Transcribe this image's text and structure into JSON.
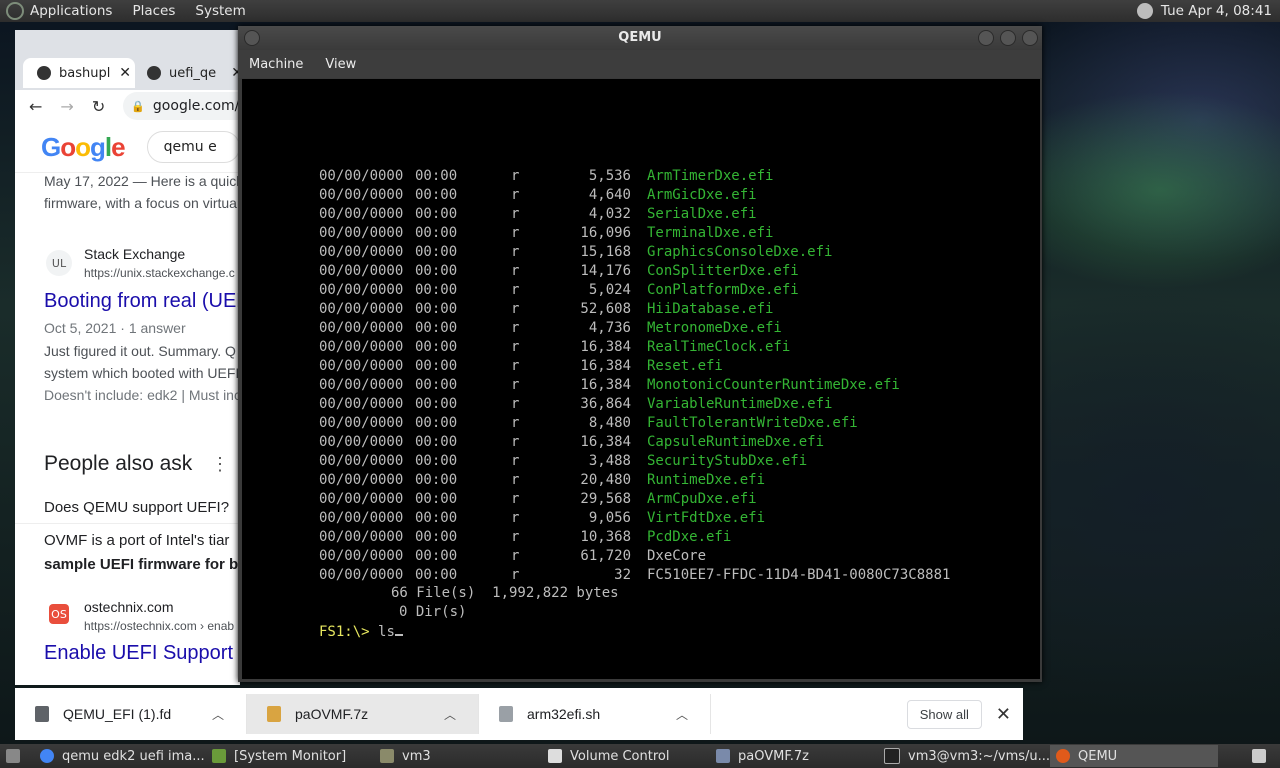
{
  "topbar": {
    "menus": [
      "Applications",
      "Places",
      "System"
    ],
    "clock": "Tue Apr  4, 08:41"
  },
  "browser": {
    "tabs": [
      {
        "label": "bashupl"
      },
      {
        "label": "uefi_qe"
      }
    ],
    "url": "google.com/",
    "search": "qemu e",
    "results": {
      "snip1_date": "May 17, 2022 — Here is a quick",
      "snip1_line2": "firmware, with a focus on virtua",
      "site1": "Stack Exchange",
      "site1_url": "https://unix.stackexchange.c",
      "title1": "Booting from real (UEF",
      "meta1": "Oct 5, 2021 · 1 answer",
      "snip2_line1": "Just figured it out. Summary. Q",
      "snip2_line2": "system which booted with UEFI",
      "snip2_line3": "Doesn't include: edk2 | Must inc",
      "paa": "People also ask",
      "q1": "Does QEMU support UEFI?",
      "a1_line1": "OVMF is a port of Intel's tiar",
      "a1_line2": "sample UEFI firmware for b",
      "site2": "ostechnix.com",
      "site2_url": "https://ostechnix.com › enab",
      "title2": "Enable UEFI Support F"
    }
  },
  "qemu": {
    "title": "QEMU",
    "menu": [
      "Machine",
      "View"
    ],
    "files": [
      {
        "date": "00/00/0000",
        "time": "00:00",
        "attr": "r",
        "size": "5,536",
        "name": "ArmTimerDxe.efi",
        "green": true
      },
      {
        "date": "00/00/0000",
        "time": "00:00",
        "attr": "r",
        "size": "4,640",
        "name": "ArmGicDxe.efi",
        "green": true
      },
      {
        "date": "00/00/0000",
        "time": "00:00",
        "attr": "r",
        "size": "4,032",
        "name": "SerialDxe.efi",
        "green": true
      },
      {
        "date": "00/00/0000",
        "time": "00:00",
        "attr": "r",
        "size": "16,096",
        "name": "TerminalDxe.efi",
        "green": true
      },
      {
        "date": "00/00/0000",
        "time": "00:00",
        "attr": "r",
        "size": "15,168",
        "name": "GraphicsConsoleDxe.efi",
        "green": true
      },
      {
        "date": "00/00/0000",
        "time": "00:00",
        "attr": "r",
        "size": "14,176",
        "name": "ConSplitterDxe.efi",
        "green": true
      },
      {
        "date": "00/00/0000",
        "time": "00:00",
        "attr": "r",
        "size": "5,024",
        "name": "ConPlatformDxe.efi",
        "green": true
      },
      {
        "date": "00/00/0000",
        "time": "00:00",
        "attr": "r",
        "size": "52,608",
        "name": "HiiDatabase.efi",
        "green": true
      },
      {
        "date": "00/00/0000",
        "time": "00:00",
        "attr": "r",
        "size": "4,736",
        "name": "MetronomeDxe.efi",
        "green": true
      },
      {
        "date": "00/00/0000",
        "time": "00:00",
        "attr": "r",
        "size": "16,384",
        "name": "RealTimeClock.efi",
        "green": true
      },
      {
        "date": "00/00/0000",
        "time": "00:00",
        "attr": "r",
        "size": "16,384",
        "name": "Reset.efi",
        "green": true
      },
      {
        "date": "00/00/0000",
        "time": "00:00",
        "attr": "r",
        "size": "16,384",
        "name": "MonotonicCounterRuntimeDxe.efi",
        "green": true
      },
      {
        "date": "00/00/0000",
        "time": "00:00",
        "attr": "r",
        "size": "36,864",
        "name": "VariableRuntimeDxe.efi",
        "green": true
      },
      {
        "date": "00/00/0000",
        "time": "00:00",
        "attr": "r",
        "size": "8,480",
        "name": "FaultTolerantWriteDxe.efi",
        "green": true
      },
      {
        "date": "00/00/0000",
        "time": "00:00",
        "attr": "r",
        "size": "16,384",
        "name": "CapsuleRuntimeDxe.efi",
        "green": true
      },
      {
        "date": "00/00/0000",
        "time": "00:00",
        "attr": "r",
        "size": "3,488",
        "name": "SecurityStubDxe.efi",
        "green": true
      },
      {
        "date": "00/00/0000",
        "time": "00:00",
        "attr": "r",
        "size": "20,480",
        "name": "RuntimeDxe.efi",
        "green": true
      },
      {
        "date": "00/00/0000",
        "time": "00:00",
        "attr": "r",
        "size": "29,568",
        "name": "ArmCpuDxe.efi",
        "green": true
      },
      {
        "date": "00/00/0000",
        "time": "00:00",
        "attr": "r",
        "size": "9,056",
        "name": "VirtFdtDxe.efi",
        "green": true
      },
      {
        "date": "00/00/0000",
        "time": "00:00",
        "attr": "r",
        "size": "10,368",
        "name": "PcdDxe.efi",
        "green": true
      },
      {
        "date": "00/00/0000",
        "time": "00:00",
        "attr": "r",
        "size": "61,720",
        "name": "DxeCore",
        "green": false
      },
      {
        "date": "00/00/0000",
        "time": "00:00",
        "attr": "r",
        "size": "32",
        "name": "FC510EE7-FFDC-11D4-BD41-0080C73C8881",
        "green": false
      }
    ],
    "summary_files": "66 File(s)  1,992,822 bytes",
    "summary_dirs": "0 Dir(s)",
    "prompt": "FS1:\\> ",
    "command": "ls"
  },
  "downloads": {
    "items": [
      {
        "label": "QEMU_EFI (1).fd"
      },
      {
        "label": "paOVMF.7z"
      },
      {
        "label": "arm32efi.sh"
      }
    ],
    "show_all": "Show all"
  },
  "taskbar": {
    "items": [
      {
        "label": "qemu edk2 uefi ima..."
      },
      {
        "label": "[System Monitor]"
      },
      {
        "label": "vm3"
      },
      {
        "label": "Volume Control"
      },
      {
        "label": "paOVMF.7z"
      },
      {
        "label": "vm3@vm3:~/vms/u..."
      },
      {
        "label": "QEMU"
      }
    ]
  },
  "colors": {
    "terminal_green": "#34b534",
    "prompt_yellow": "#e8e860",
    "link_blue": "#1a0dab"
  }
}
